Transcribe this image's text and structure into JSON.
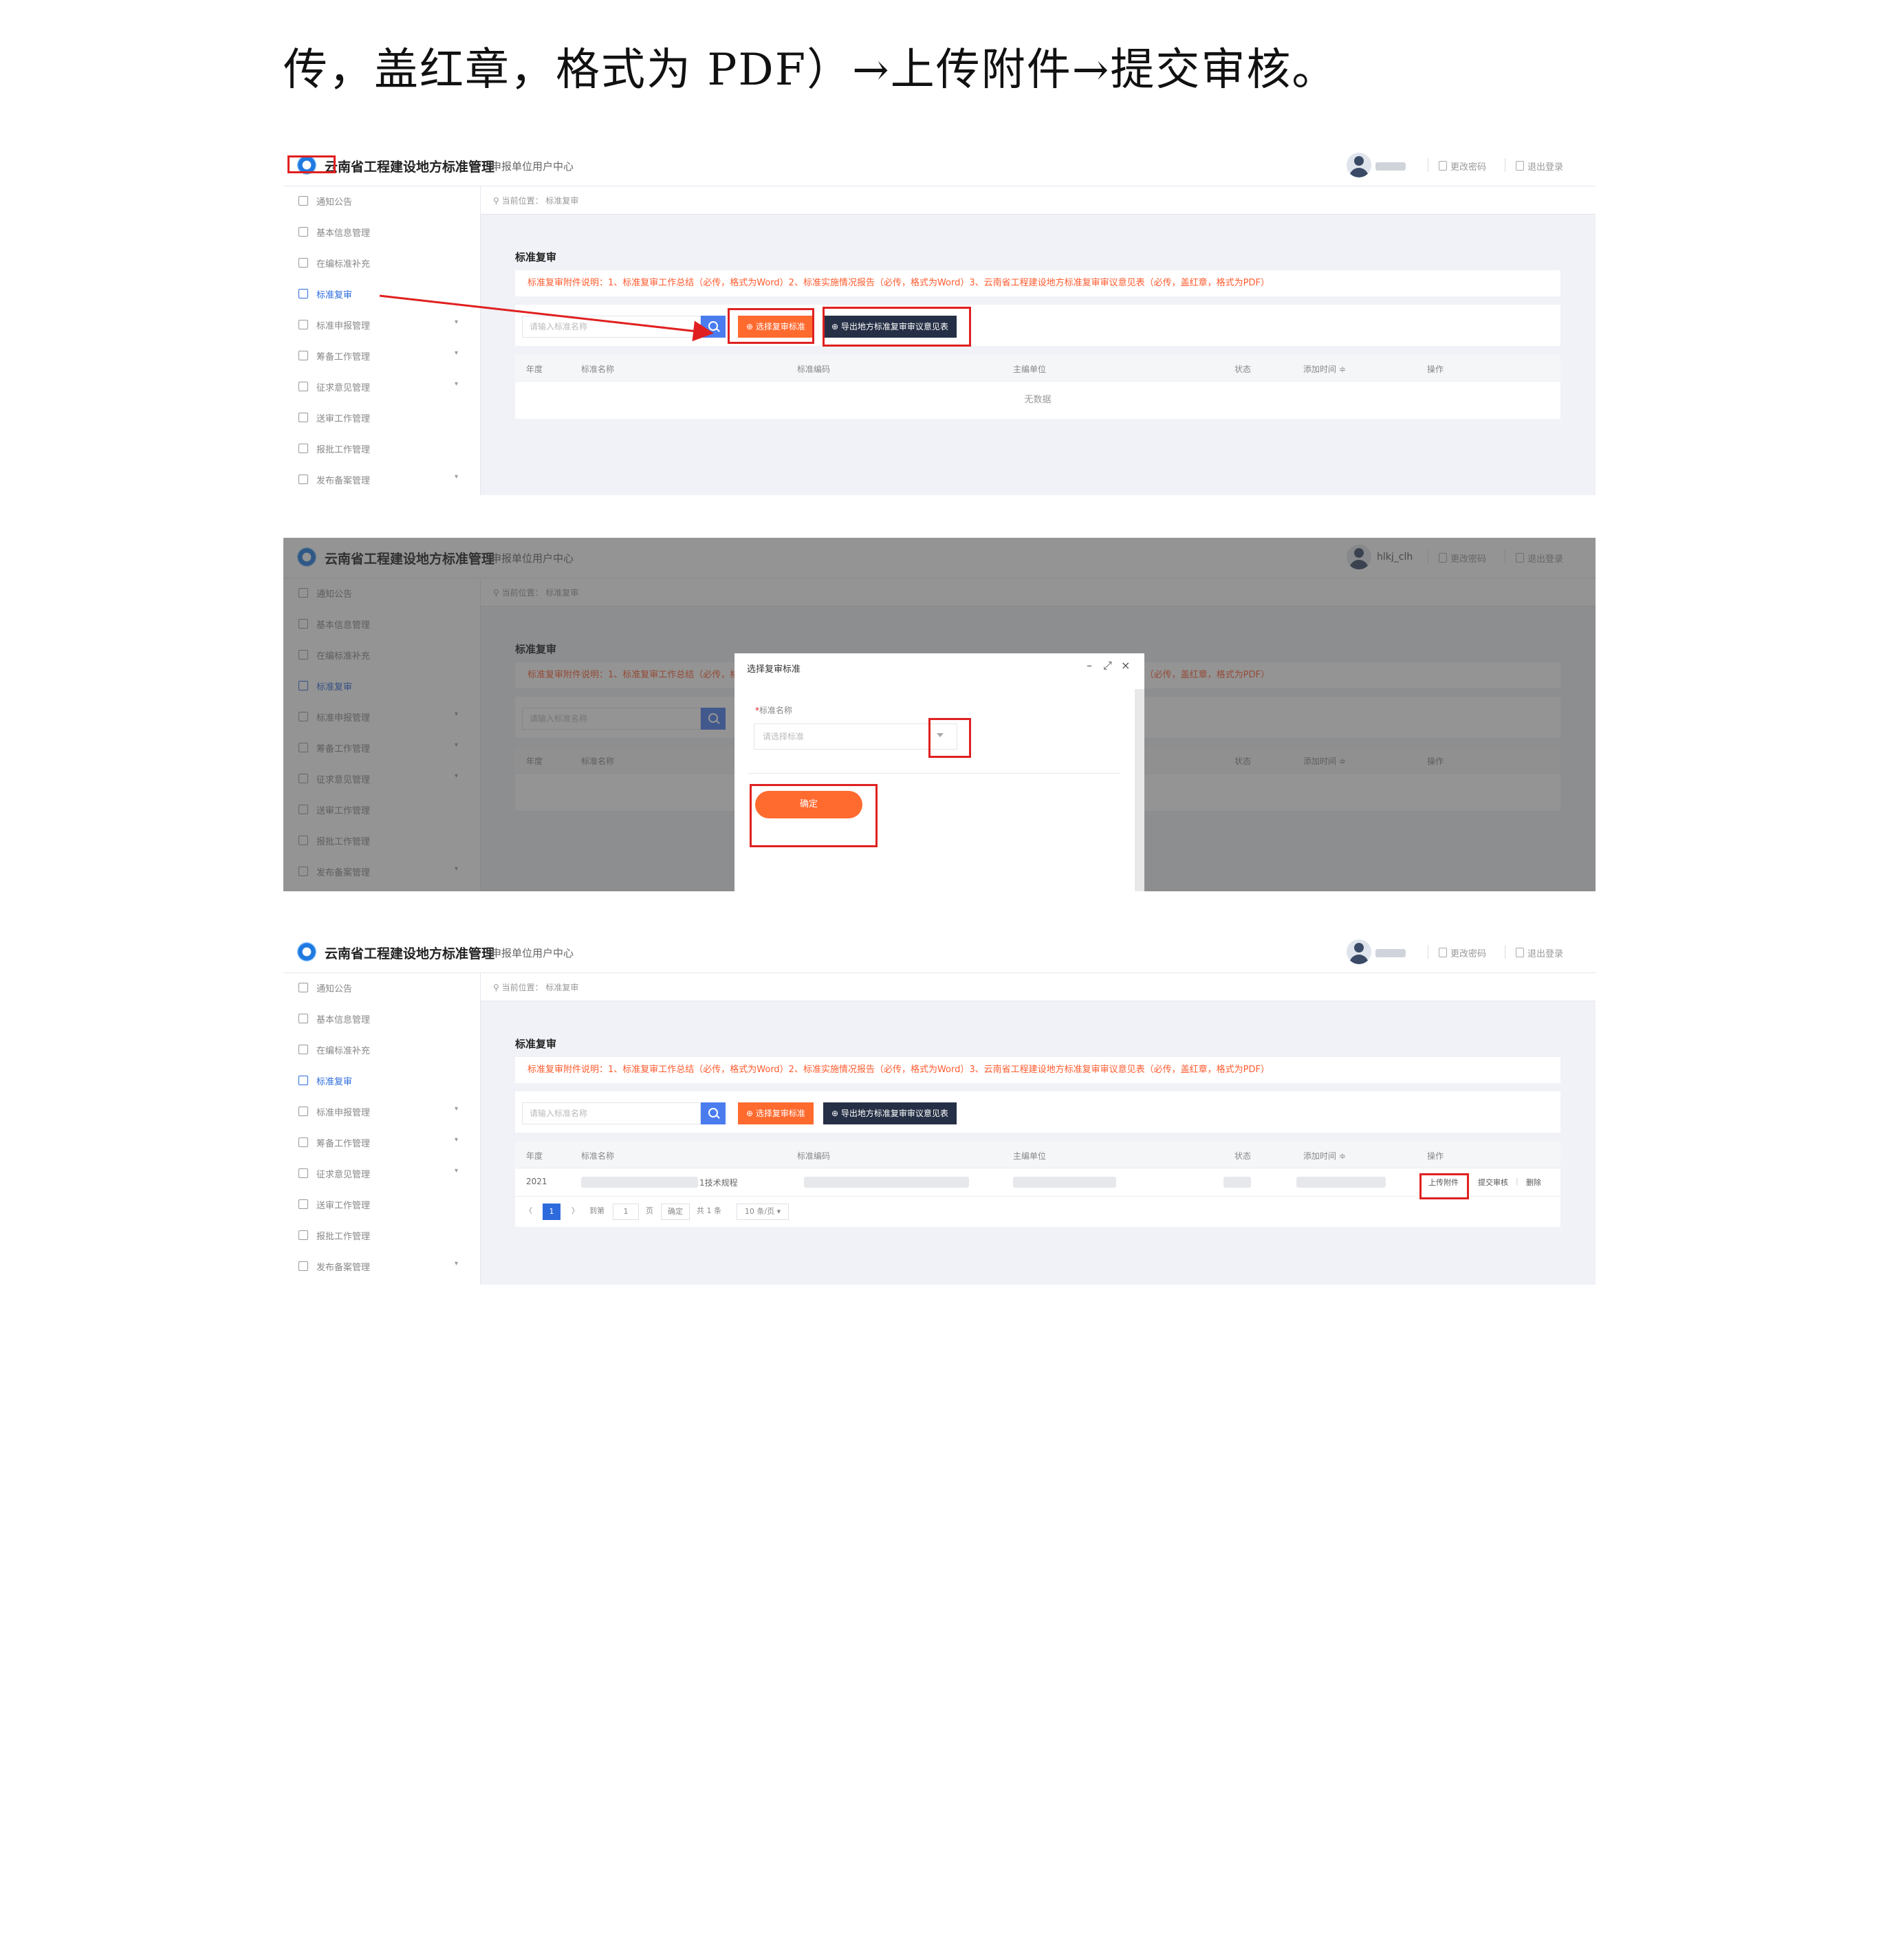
{
  "caption": "传，盖红章，格式为 PDF）→上传附件→提交审核。",
  "app": {
    "title": "云南省工程建设地方标准管理",
    "subtitle": "申报单位用户中心",
    "change_password": "更改密码",
    "logout": "退出登录",
    "username": "hlkj_clh"
  },
  "sidebar": {
    "items": [
      {
        "label": "通知公告",
        "has_arrow": false
      },
      {
        "label": "基本信息管理",
        "has_arrow": false
      },
      {
        "label": "在编标准补充",
        "has_arrow": false
      },
      {
        "label": "标准复审",
        "has_arrow": false,
        "active": true
      },
      {
        "label": "标准申报管理",
        "has_arrow": true
      },
      {
        "label": "筹备工作管理",
        "has_arrow": true
      },
      {
        "label": "征求意见管理",
        "has_arrow": true
      },
      {
        "label": "送审工作管理",
        "has_arrow": false
      },
      {
        "label": "报批工作管理",
        "has_arrow": false
      },
      {
        "label": "发布备案管理",
        "has_arrow": true
      }
    ]
  },
  "main": {
    "breadcrumb": "当前位置：  标准复审",
    "page_title": "标准复审",
    "notice": "标准复审附件说明：1、标准复审工作总结（必传，格式为Word）2、标准实施情况报告（必传，格式为Word）3、云南省工程建设地方标准复审审议意见表（必传，盖红章，格式为PDF）",
    "search_placeholder": "请输入标准名称",
    "select_button": "选择复审标准",
    "export_button": "导出地方标准复审审议意见表",
    "columns": [
      "年度",
      "标准名称",
      "标准编码",
      "主编单位",
      "状态",
      "添加时间 ≑",
      "操作"
    ],
    "empty_text": "无数据"
  },
  "modal": {
    "title": "选择复审标准",
    "field_label": "标准名称",
    "required_mark": "*",
    "select_placeholder": "请选择标准",
    "confirm": "确定",
    "ctrl_minimize": "–",
    "ctrl_maximize": "⤢",
    "ctrl_close": "×"
  },
  "result": {
    "row": {
      "year": "2021",
      "name_tail": "1技术规程"
    },
    "ops": {
      "upload": "上传附件",
      "submit": "提交审核",
      "sep": "|",
      "delete": "删除"
    },
    "pager": {
      "prev": "〈",
      "current": "1",
      "next": "〉",
      "goto": "到第",
      "page_input": "1",
      "page_unit": "页",
      "confirm": "确定",
      "total": "共 1 条",
      "page_size": "10 条/页 ▾"
    }
  },
  "colors": {
    "accent_orange": "#ff6a2f",
    "dark_button": "#252f45",
    "primary_blue": "#2d6bdc",
    "highlight_red": "#e02020",
    "notice_red": "#ff5b2e"
  }
}
